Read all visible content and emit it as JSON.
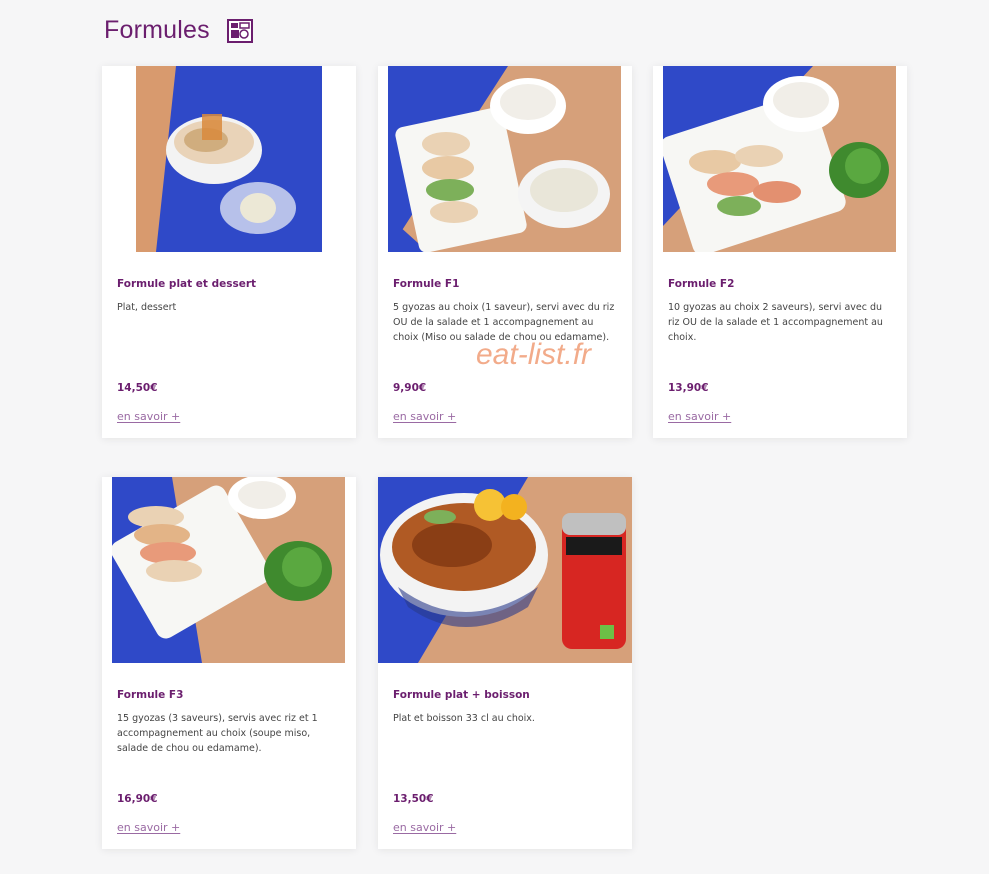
{
  "section": {
    "title": "Formules",
    "icon": "menu-tray-icon"
  },
  "watermark": "eat-list.fr",
  "colors": {
    "accent": "#6b1e6e",
    "link": "#9a6aa3",
    "background": "#f6f6f7",
    "card": "#ffffff"
  },
  "cards": [
    {
      "title": "Formule plat et dessert",
      "description": "Plat, dessert",
      "price": "14,50€",
      "link": "en savoir +",
      "image": "donburi-and-dessert-photo"
    },
    {
      "title": "Formule F1",
      "description": "5 gyozas au choix (1 saveur), servi avec du riz OU de la salade et 1 accompagnement au choix (Miso ou salade de chou ou edamame).",
      "price": "9,90€",
      "link": "en savoir +",
      "image": "gyozas-rice-salad-photo"
    },
    {
      "title": "Formule F2",
      "description": "10 gyozas au choix 2 saveurs), servi avec du riz OU de la salade et 1 accompagnement au choix.",
      "price": "13,90€",
      "link": "en savoir +",
      "image": "gyozas-rice-edamame-photo"
    },
    {
      "title": "Formule F3",
      "description": "15 gyozas (3 saveurs), servis avec riz et 1 accompagnement au choix (soupe miso, salade de chou ou edamame).",
      "price": "16,90€",
      "link": "en savoir +",
      "image": "gyozas-rice-edamame-photo-2"
    },
    {
      "title": "Formule plat + boisson",
      "description": "Plat et boisson 33 cl au choix.",
      "price": "13,50€",
      "link": "en savoir +",
      "image": "donburi-and-soda-photo"
    }
  ]
}
